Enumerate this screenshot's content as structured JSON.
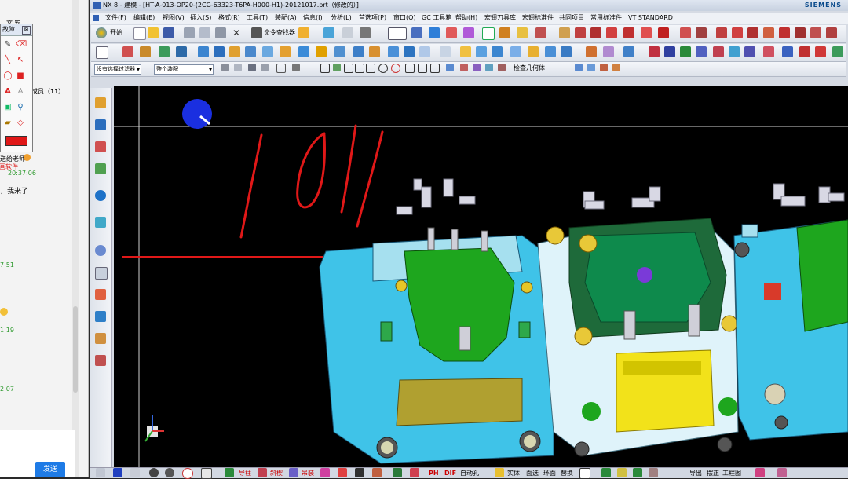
{
  "chat": {
    "members_label": "成员（11）",
    "sender_name": "送给老师",
    "time_1": "20:37:06",
    "message_1": "，我来了",
    "time_2": "7:51",
    "time_3": "1:19",
    "time_4": "2:07",
    "software_label": "画软件",
    "send_button": "发送"
  },
  "palette": {
    "title": "故障"
  },
  "app": {
    "title": "NX 8 - 建模 - [HT-A-013-OP20-(2CG-63323-T6PA-H000-H1)-20121017.prt（修改的）]",
    "brand": "SIEMENS",
    "menu": [
      "文件(F)",
      "编辑(E)",
      "视图(V)",
      "插入(S)",
      "格式(R)",
      "工具(T)",
      "装配(A)",
      "信息(I)",
      "分析(L)",
      "首选项(P)",
      "窗口(O)",
      "GC 工具箱",
      "帮助(H)",
      "宏翅刀具库",
      "宏翅标准件",
      "共同项目",
      "常用标准件",
      "VT STANDARD"
    ],
    "toolbar1": {
      "start_label": "开始",
      "command_finder_label": "命令查找器"
    },
    "toolbar3": {
      "filter_combo": "没有选择过滤器",
      "scope_combo": "整个装配",
      "check_geometry_label": "检查几何体"
    },
    "status": {
      "labels": [
        "导柱",
        "斜楔",
        "吊装",
        "PH",
        "DIF",
        "自动孔",
        "实体",
        "面选",
        "环面",
        "替换",
        "导出",
        "摆正",
        "工程图"
      ]
    }
  },
  "colors": {
    "background": "#000000",
    "annotation_red": "#e01818",
    "cursor_blue": "#1a2fe0",
    "die_cyan": "#3fc3e8",
    "die_green": "#1ea61e",
    "die_yellow": "#f2e21a"
  }
}
